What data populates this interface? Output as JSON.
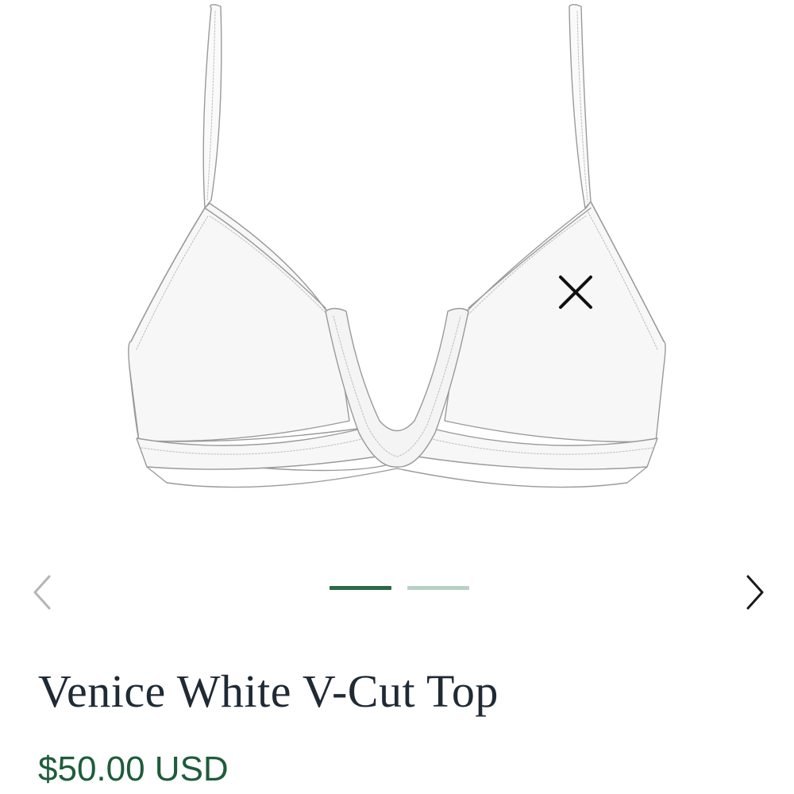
{
  "product": {
    "title": "Venice White V-Cut Top",
    "price": "$50.00 USD",
    "image_icon": "bikini-top-illustration"
  },
  "gallery": {
    "current_index": 1,
    "total_images": 2,
    "prev_icon": "chevron-left-icon",
    "next_icon": "chevron-right-icon",
    "close_icon": "close-icon"
  },
  "colors": {
    "accent": "#1e5c3b",
    "indicator_active": "#2a6a46",
    "indicator_inactive": "#b7d1c4",
    "title_text": "#1f2a35",
    "prev_arrow": "#b5b5b5",
    "next_arrow": "#1a1a1a"
  }
}
